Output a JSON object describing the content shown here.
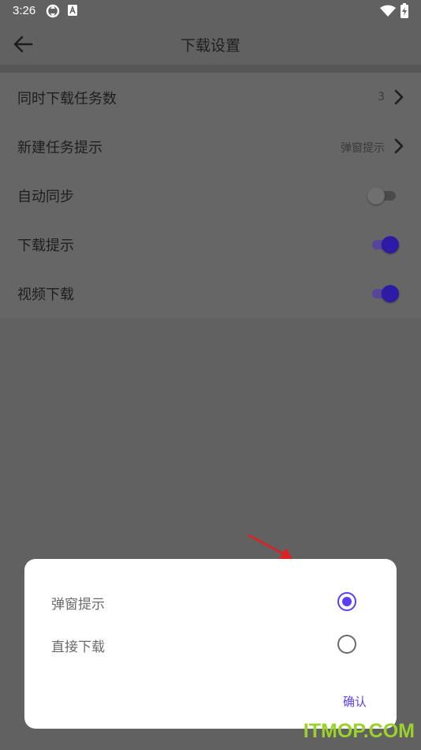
{
  "status_bar": {
    "time": "3:26",
    "icons": [
      "sync-icon",
      "keyboard-a-icon",
      "wifi-icon",
      "battery-charging-icon"
    ]
  },
  "toolbar": {
    "title": "下载设置",
    "back_icon": "arrow-left-icon"
  },
  "settings": {
    "concurrent_downloads": {
      "label": "同时下载任务数",
      "value": "3"
    },
    "new_task_prompt": {
      "label": "新建任务提示",
      "value": "弹窗提示"
    },
    "auto_sync": {
      "label": "自动同步",
      "enabled": false
    },
    "download_prompt": {
      "label": "下载提示",
      "enabled": true
    },
    "video_download": {
      "label": "视频下载",
      "enabled": true
    }
  },
  "dialog": {
    "options": [
      {
        "label": "弹窗提示",
        "selected": true
      },
      {
        "label": "直接下载",
        "selected": false
      }
    ],
    "confirm_label": "确认"
  },
  "watermark": "ITMOP.COM",
  "colors": {
    "accent": "#5b3ff0",
    "toggle_on": "#2e1ba5",
    "overlay": "#616161",
    "annotation_arrow": "#e02020",
    "watermark": "#9bd12b"
  }
}
